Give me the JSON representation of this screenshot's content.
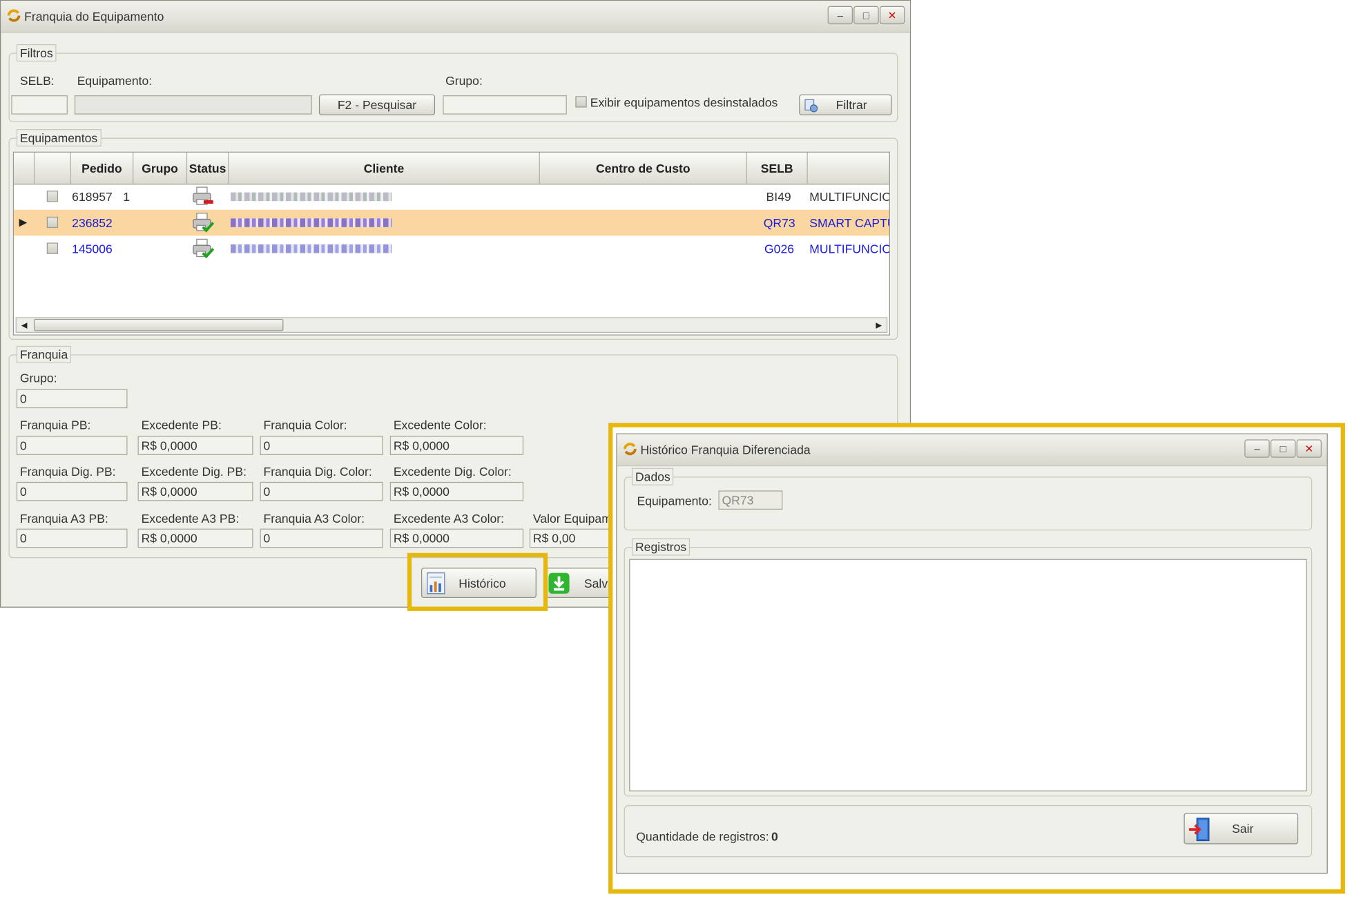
{
  "main": {
    "title": "Franquia do Equipamento",
    "filtros": {
      "legend": "Filtros",
      "selb_label": "SELB:",
      "equip_label": "Equipamento:",
      "grupo_label": "Grupo:",
      "pesquisar_btn": "F2 - Pesquisar",
      "exibir_label": "Exibir equipamentos desinstalados",
      "filtrar_btn": "Filtrar"
    },
    "equipamentos": {
      "legend": "Equipamentos",
      "columns": [
        "Pedido",
        "Grupo",
        "Status",
        "Cliente",
        "Centro de Custo",
        "SELB"
      ],
      "rows": [
        {
          "pedido": "618957",
          "grupo": "1",
          "selb": "BI49",
          "tipo": "MULTIFUNCIO"
        },
        {
          "pedido": "236852",
          "grupo": "",
          "selb": "QR73",
          "tipo": "SMART CAPTU"
        },
        {
          "pedido": "145006",
          "grupo": "",
          "selb": "G026",
          "tipo": "MULTIFUNCIO"
        }
      ]
    },
    "franquia": {
      "legend": "Franquia",
      "grupo_label": "Grupo:",
      "grupo_value": "0",
      "fields": [
        {
          "label": "Franquia PB:",
          "value": "0"
        },
        {
          "label": "Excedente PB:",
          "value": "R$ 0,0000"
        },
        {
          "label": "Franquia Color:",
          "value": "0"
        },
        {
          "label": "Excedente Color:",
          "value": "R$ 0,0000"
        },
        {
          "label": "Franquia Dig. PB:",
          "value": "0"
        },
        {
          "label": "Excedente Dig. PB:",
          "value": "R$ 0,0000"
        },
        {
          "label": "Franquia Dig. Color:",
          "value": "0"
        },
        {
          "label": "Excedente Dig. Color:",
          "value": "R$ 0,0000"
        },
        {
          "label": "Franquia A3 PB:",
          "value": "0"
        },
        {
          "label": "Excedente A3 PB:",
          "value": "R$ 0,0000"
        },
        {
          "label": "Franquia A3 Color:",
          "value": "0"
        },
        {
          "label": "Excedente A3 Color:",
          "value": "R$ 0,0000"
        },
        {
          "label": "Valor Equipamen",
          "value": "R$ 0,00"
        }
      ]
    },
    "historico_btn": "Histórico",
    "salvar_btn": "Salva"
  },
  "dialog": {
    "title": "Histórico Franquia Diferenciada",
    "dados_legend": "Dados",
    "equip_label": "Equipamento:",
    "equip_value": "QR73",
    "registros_legend": "Registros",
    "qtd_label": "Quantidade de registros:",
    "qtd_value": "0",
    "sair_btn": "Sair"
  },
  "colors": {
    "highlight": "#e5b80b",
    "selected_row": "#fad7a0",
    "link_blue": "#1a1ae0"
  }
}
